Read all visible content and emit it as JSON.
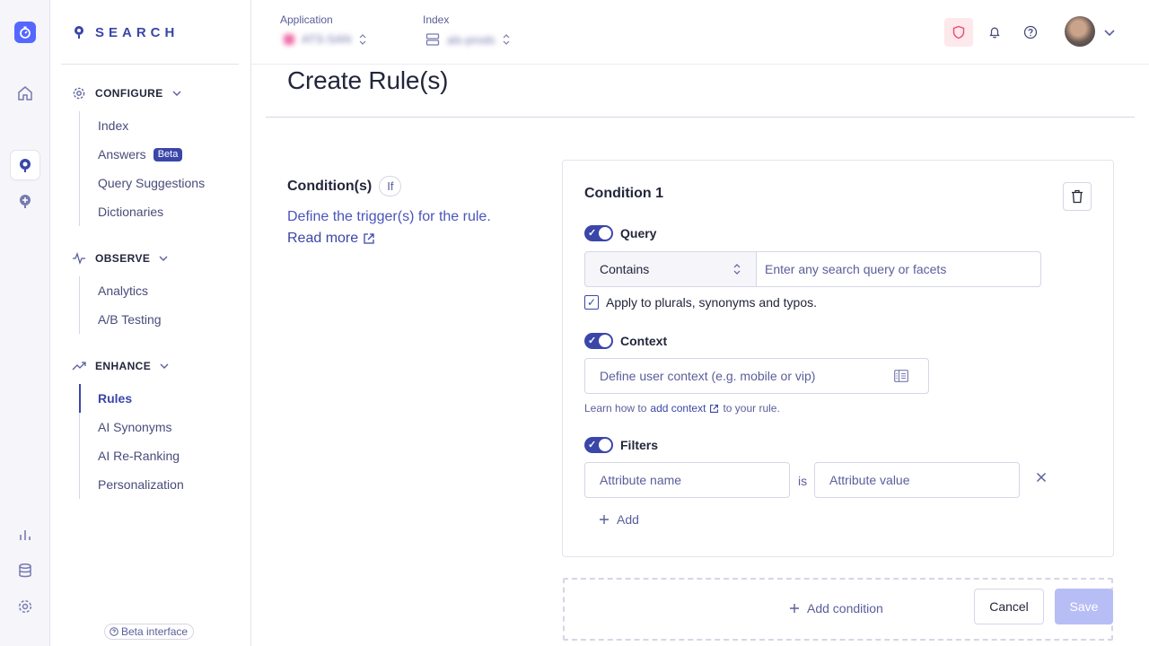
{
  "brand": {
    "name": "SEARCH"
  },
  "rail": {
    "icons": [
      "app-logo-icon",
      "home-icon",
      "search-product-icon",
      "recommend-product-icon",
      "bar-chart-icon",
      "database-icon",
      "settings-icon"
    ]
  },
  "sidebar": {
    "sections": [
      {
        "title": "CONFIGURE",
        "items": [
          "Index",
          "Answers",
          "Query Suggestions",
          "Dictionaries"
        ]
      },
      {
        "title": "OBSERVE",
        "items": [
          "Analytics",
          "A/B Testing"
        ]
      },
      {
        "title": "ENHANCE",
        "items": [
          "Rules",
          "AI Synonyms",
          "AI Re-Ranking",
          "Personalization"
        ]
      }
    ],
    "answers_badge": "Beta",
    "active_item": "Rules",
    "beta_interface": "Beta interface"
  },
  "topbar": {
    "application_label": "Application",
    "application_value": "ATS-SAN",
    "index_label": "Index",
    "index_value": "als-prods"
  },
  "page": {
    "title": "Create Rule(s)",
    "conditions_title": "Condition(s)",
    "if_pill": "If",
    "description": "Define the trigger(s) for the rule.",
    "read_more": "Read more"
  },
  "condition": {
    "title": "Condition 1",
    "query": {
      "label": "Query",
      "enabled": true,
      "operator": "Contains",
      "placeholder": "Enter any search query or facets",
      "apply_plurals_label": "Apply to plurals, synonyms and typos.",
      "apply_plurals_checked": true
    },
    "context": {
      "label": "Context",
      "enabled": true,
      "placeholder": "Define user context (e.g. mobile or vip)",
      "hint_prefix": "Learn how to",
      "hint_link": "add context",
      "hint_suffix": "to your rule."
    },
    "filters": {
      "label": "Filters",
      "enabled": true,
      "attribute_name_placeholder": "Attribute name",
      "is_label": "is",
      "attribute_value_placeholder": "Attribute value",
      "add_label": "Add"
    }
  },
  "footer": {
    "add_condition": "Add condition",
    "cancel": "Cancel",
    "save": "Save"
  },
  "colors": {
    "accent": "#3a46a8",
    "brand_blue": "#5468ff",
    "save_disabled": "#b7bdf5",
    "alert_pink": "#fde8ec"
  }
}
